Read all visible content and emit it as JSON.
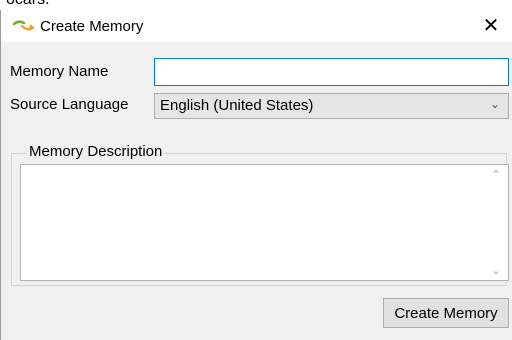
{
  "background_text": "ocars.",
  "dialog": {
    "title": "Create Memory",
    "close_glyph": "✕",
    "icon": "translation-arrow-icon"
  },
  "form": {
    "memory_name_label": "Memory Name",
    "memory_name_value": "",
    "source_language_label": "Source Language",
    "source_language_value": "English (United States)",
    "description_group_label": "Memory Description",
    "description_value": ""
  },
  "buttons": {
    "create_label": "Create Memory"
  },
  "colors": {
    "accent": "#0078d7",
    "icon_green": "#6ab023",
    "icon_orange": "#e8a317",
    "body_bg": "#f0f0f0"
  }
}
